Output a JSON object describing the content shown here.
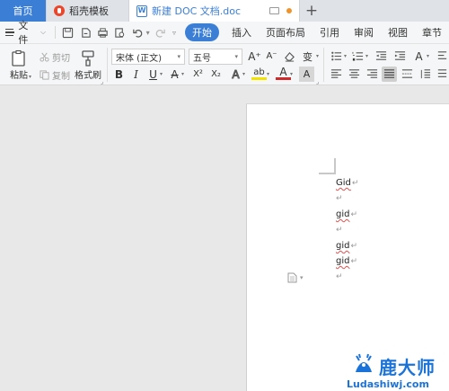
{
  "tabs": {
    "home": "首页",
    "templates": "稻壳模板",
    "document": "新建 DOC 文档.doc",
    "new_tab": "+"
  },
  "menu": {
    "file": "文件",
    "items": [
      "开始",
      "插入",
      "页面布局",
      "引用",
      "审阅",
      "视图",
      "章节"
    ],
    "active_index": 0
  },
  "ribbon": {
    "paste": "粘贴",
    "cut": "剪切",
    "copy": "复制",
    "format_painter": "格式刷",
    "font_name": "宋体 (正文)",
    "font_size": "五号",
    "bold": "B",
    "italic": "I",
    "underline": "U",
    "strike": "A",
    "superscript": "X²",
    "subscript": "X₂",
    "grow_font": "A⁺",
    "shrink_font": "A⁻",
    "clear_format": "◇",
    "phonetic": "变",
    "text_effect": "A",
    "highlight": "ab",
    "font_color": "A",
    "char_shading": "A",
    "style_a": "A"
  },
  "document": {
    "lines": [
      {
        "text": "Gid",
        "mark": "↵"
      },
      {
        "text": "",
        "mark": "↵"
      },
      {
        "text": "gid",
        "mark": "↵"
      },
      {
        "text": "",
        "mark": "↵"
      },
      {
        "text": "gid",
        "mark": "↵"
      },
      {
        "text": "gid",
        "mark": "↵"
      },
      {
        "text": "",
        "mark": "↵"
      }
    ]
  },
  "watermark": {
    "brand": "鹿大师",
    "url": "Ludashiwj.com"
  },
  "colors": {
    "accent": "#3b7ed6",
    "tab_bar": "#dfe3e8",
    "ribbon": "#f5f6f7",
    "workspace": "#e8e8e8",
    "spell_error": "#e05050",
    "watermark": "#1a73d9",
    "flame": "#e9462b",
    "unsaved_dot": "#f0932b"
  }
}
